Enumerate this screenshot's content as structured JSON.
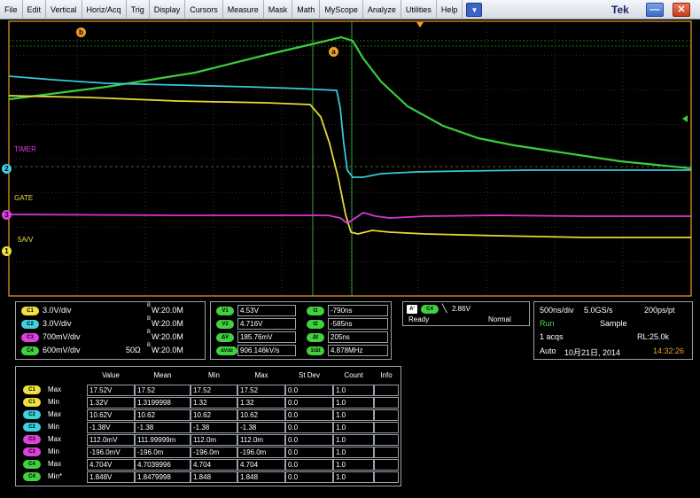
{
  "menu": {
    "items": [
      "File",
      "Edit",
      "Vertical",
      "Horiz/Acq",
      "Trig",
      "Display",
      "Cursors",
      "Measure",
      "Mask",
      "Math",
      "MyScope",
      "Analyze",
      "Utilities",
      "Help"
    ],
    "brand": "Tek"
  },
  "scope": {
    "labels": {
      "timer": "TIMER",
      "gate": "GATE",
      "five_av": "5A/V"
    },
    "cursor_a": "a",
    "cursor_b": "b",
    "markers": {
      "ch2": "2",
      "ch3": "3",
      "ch1": "1"
    },
    "colors": {
      "ch1": "#f0e040",
      "ch2": "#40d0e0",
      "ch3": "#e040e0",
      "ch4": "#40d040"
    }
  },
  "channels": [
    {
      "badge": "C1",
      "scale": "3.0V/div",
      "term": "",
      "bw_b": "B",
      "bw": "W:20.0M",
      "color": "#f0e040"
    },
    {
      "badge": "C2",
      "scale": "3.0V/div",
      "term": "",
      "bw_b": "B",
      "bw": "W:20.0M",
      "color": "#40d0e0"
    },
    {
      "badge": "C3",
      "scale": "700mV/div",
      "term": "",
      "bw_b": "B",
      "bw": "W:20.0M",
      "color": "#e040e0"
    },
    {
      "badge": "C4",
      "scale": "600mV/div",
      "term": "50Ω",
      "bw_b": "B",
      "bw": "W:20.0M",
      "color": "#40d040"
    }
  ],
  "cursors": {
    "v1_label": "V1",
    "v1": "4.53V",
    "v2_label": "V2",
    "v2": "4.716V",
    "dv_label": "ΔV",
    "dv": "185.76mV",
    "dvdt_label": "ΔV/Δt",
    "dvdt": "906.146kV/s",
    "t1_label": "t1",
    "t1": "-790ns",
    "t2_label": "t2",
    "t2": "-585ns",
    "dt_label": "Δt",
    "dt": "205ns",
    "inv_label": "1/Δt",
    "inv": "4.878MHz"
  },
  "trigger": {
    "a_label": "A'",
    "ch_label": "C4",
    "level": "2.86V",
    "state": "Ready",
    "mode": "Normal"
  },
  "acq": {
    "timebase": "500ns/div",
    "rate": "5.0GS/s",
    "res": "200ps/pt",
    "run": "Run",
    "sample": "Sample",
    "acqs": "1 acqs",
    "rl": "RL:25.0k",
    "auto": "Auto",
    "date": "10月21日, 2014",
    "time": "14:32:26"
  },
  "measurements": {
    "headers": [
      "Value",
      "Mean",
      "Min",
      "Max",
      "St Dev",
      "Count",
      "Info"
    ],
    "rows": [
      {
        "badge": "C1",
        "type": "Max",
        "value": "17.52V",
        "mean": "17.52",
        "min": "17.52",
        "max": "17.52",
        "stdev": "0.0",
        "count": "1.0",
        "color": "#f0e040"
      },
      {
        "badge": "C1",
        "type": "Min",
        "value": "1.32V",
        "mean": "1.3199998",
        "min": "1.32",
        "max": "1.32",
        "stdev": "0.0",
        "count": "1.0",
        "color": "#f0e040"
      },
      {
        "badge": "C2",
        "type": "Max",
        "value": "10.62V",
        "mean": "10.62",
        "min": "10.62",
        "max": "10.62",
        "stdev": "0.0",
        "count": "1.0",
        "color": "#40d0e0"
      },
      {
        "badge": "C2",
        "type": "Min",
        "value": "-1.38V",
        "mean": "-1.38",
        "min": "-1.38",
        "max": "-1.38",
        "stdev": "0.0",
        "count": "1.0",
        "color": "#40d0e0"
      },
      {
        "badge": "C3",
        "type": "Max",
        "value": "112.0mV",
        "mean": "111.99999m",
        "min": "112.0m",
        "max": "112.0m",
        "stdev": "0.0",
        "count": "1.0",
        "color": "#e040e0"
      },
      {
        "badge": "C3",
        "type": "Min",
        "value": "-196.0mV",
        "mean": "-196.0m",
        "min": "-196.0m",
        "max": "-196.0m",
        "stdev": "0.0",
        "count": "1.0",
        "color": "#e040e0"
      },
      {
        "badge": "C4",
        "type": "Max",
        "value": "4.704V",
        "mean": "4.7039996",
        "min": "4.704",
        "max": "4.704",
        "stdev": "0.0",
        "count": "1.0",
        "color": "#40d040"
      },
      {
        "badge": "C4",
        "type": "Min*",
        "value": "1.848V",
        "mean": "1.8479998",
        "min": "1.848",
        "max": "1.848",
        "stdev": "0.0",
        "count": "1.0",
        "color": "#40d040"
      }
    ]
  }
}
